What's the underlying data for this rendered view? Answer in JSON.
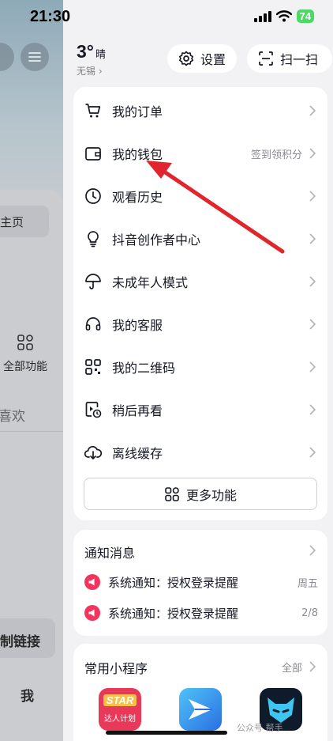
{
  "status": {
    "time": "21:30",
    "battery": "74"
  },
  "left_panel": {
    "home_tab": "主页",
    "all_functions": "全部功能",
    "likes": "喜欢",
    "copy_link": "制链接",
    "me": "我"
  },
  "weather": {
    "temp": "3°",
    "condition": "晴",
    "city": "无锡"
  },
  "header": {
    "settings_label": "设置",
    "scan_label": "扫一扫"
  },
  "menu": {
    "items": [
      {
        "label": "我的订单",
        "hint": "",
        "icon": "cart-icon"
      },
      {
        "label": "我的钱包",
        "hint": "签到领积分",
        "icon": "wallet-icon"
      },
      {
        "label": "观看历史",
        "hint": "",
        "icon": "clock-icon"
      },
      {
        "label": "抖音创作者中心",
        "hint": "",
        "icon": "lightbulb-icon"
      },
      {
        "label": "未成年人模式",
        "hint": "",
        "icon": "umbrella-icon"
      },
      {
        "label": "我的客服",
        "hint": "",
        "icon": "headset-icon"
      },
      {
        "label": "我的二维码",
        "hint": "",
        "icon": "qrcode-icon"
      },
      {
        "label": "稍后再看",
        "hint": "",
        "icon": "watch-later-icon"
      },
      {
        "label": "离线缓存",
        "hint": "",
        "icon": "download-cloud-icon"
      }
    ],
    "more_label": "更多功能"
  },
  "notifications": {
    "title": "通知消息",
    "items": [
      {
        "text": "系统通知：授权登录提醒",
        "date": "周五"
      },
      {
        "text": "系统通知：授权登录提醒",
        "date": "2/8"
      }
    ]
  },
  "mini_apps": {
    "title": "常用小程序",
    "all_label": "全部",
    "apps": [
      {
        "icon": "star-plan-app-icon",
        "label_top": "STAR",
        "label_bottom": "达人计划"
      },
      {
        "icon": "paper-plane-app-icon"
      },
      {
        "icon": "fox-mask-app-icon"
      }
    ]
  },
  "watermark": "公众号 帮手",
  "colors": {
    "accent_red": "#e0262c",
    "notif_red": "#f3345d",
    "battery_green": "#4cd964"
  }
}
